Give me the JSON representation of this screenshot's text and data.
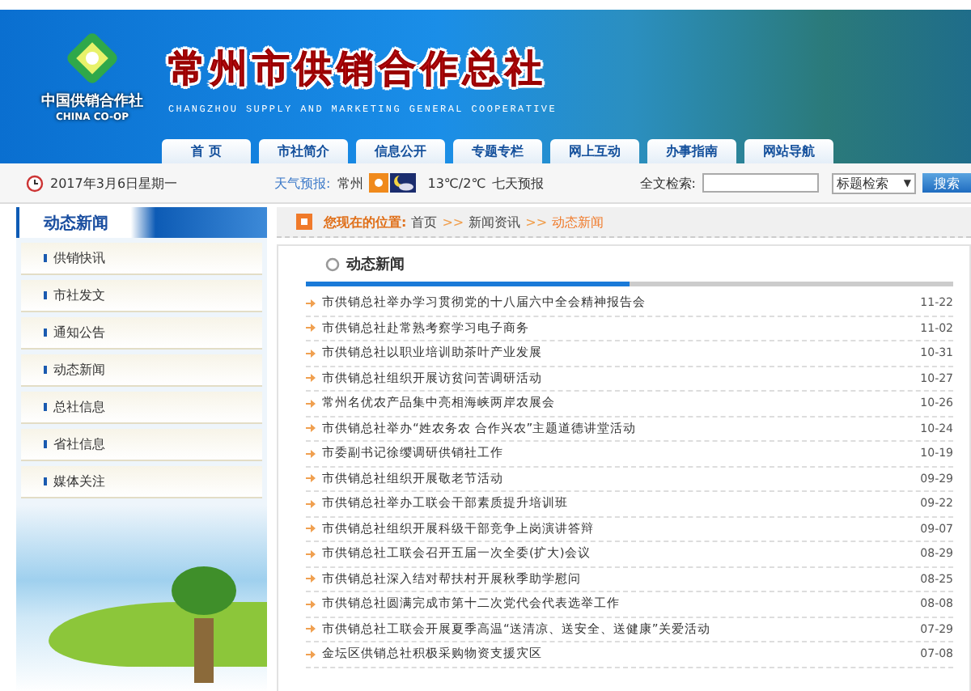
{
  "header": {
    "logo_cn": "中国供销合作社",
    "logo_en": "CHINA CO-OP",
    "title": "常州市供销合作总社",
    "subtitle": "CHANGZHOU SUPPLY AND MARKETING GENERAL COOPERATIVE"
  },
  "nav": [
    "首 页",
    "市社简介",
    "信息公开",
    "专题专栏",
    "网上互动",
    "办事指南",
    "网站导航"
  ],
  "infobar": {
    "date": "2017年3月6日星期一",
    "weather_label": "天气预报:",
    "city": "常州",
    "temperature": "13℃/2℃",
    "forecast_link": "七天预报",
    "search_label": "全文检索:",
    "search_type": "标题检索",
    "search_type_arrow": "▼",
    "search_button": "搜索"
  },
  "sidebar": {
    "title": "动态新闻",
    "items": [
      "供销快讯",
      "市社发文",
      "通知公告",
      "动态新闻",
      "总社信息",
      "省社信息",
      "媒体关注"
    ]
  },
  "breadcrumb": {
    "label": "您现在的位置:",
    "separator": ">>",
    "path": [
      {
        "text": "首页",
        "current": false
      },
      {
        "text": "新闻资讯",
        "current": false
      },
      {
        "text": "动态新闻",
        "current": true
      }
    ]
  },
  "panel": {
    "title": "动态新闻",
    "news": [
      {
        "title": "市供销总社举办学习贯彻党的十八届六中全会精神报告会",
        "date": "11-22"
      },
      {
        "title": "市供销总社赴常熟考察学习电子商务",
        "date": "11-02"
      },
      {
        "title": "市供销总社以职业培训助茶叶产业发展",
        "date": "10-31"
      },
      {
        "title": "市供销总社组织开展访贫问苦调研活动",
        "date": "10-27"
      },
      {
        "title": "常州名优农产品集中亮相海峡两岸农展会",
        "date": "10-26"
      },
      {
        "title": "市供销总社举办“姓农务农 合作兴农”主题道德讲堂活动",
        "date": "10-24"
      },
      {
        "title": "市委副书记徐缨调研供销社工作",
        "date": "10-19"
      },
      {
        "title": "市供销总社组织开展敬老节活动",
        "date": "09-29"
      },
      {
        "title": "市供销总社举办工联会干部素质提升培训班",
        "date": "09-22"
      },
      {
        "title": "市供销总社组织开展科级干部竞争上岗演讲答辩",
        "date": "09-07"
      },
      {
        "title": "市供销总社工联会召开五届一次全委(扩大)会议",
        "date": "08-29"
      },
      {
        "title": "市供销总社深入结对帮扶村开展秋季助学慰问",
        "date": "08-25"
      },
      {
        "title": "市供销总社圆满完成市第十二次党代会代表选举工作",
        "date": "08-08"
      },
      {
        "title": "市供销总社工联会开展夏季高温“送清凉、送安全、送健康”关爱活动",
        "date": "07-29"
      },
      {
        "title": "金坛区供销总社积极采购物资支援灾区",
        "date": "07-08"
      }
    ]
  }
}
